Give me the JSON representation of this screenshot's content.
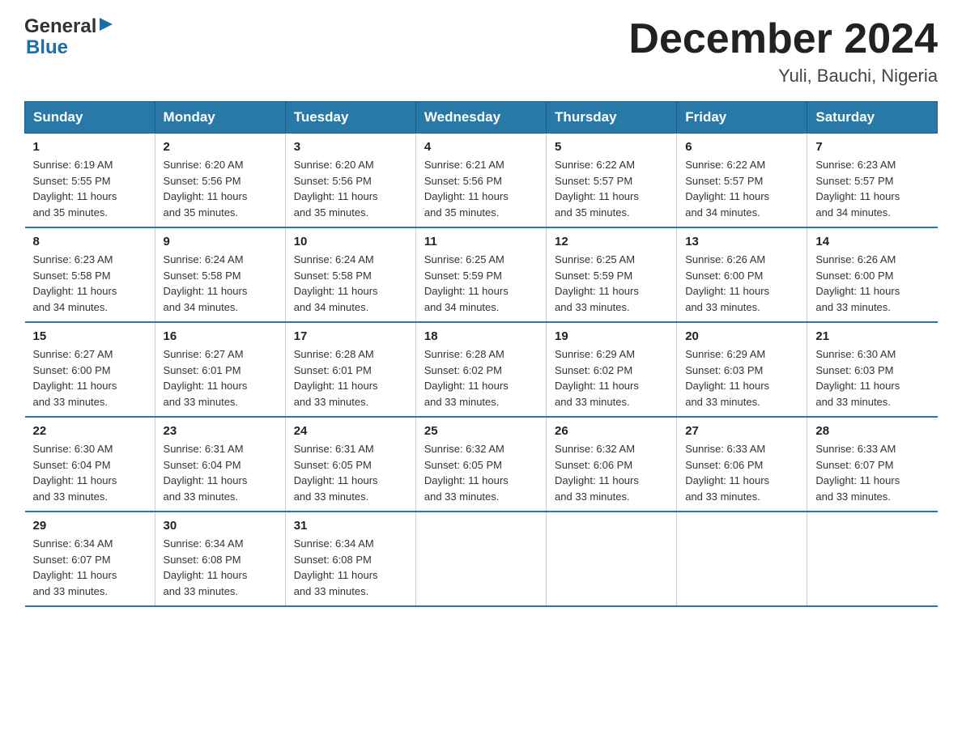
{
  "logo": {
    "general": "General",
    "arrow": "▶",
    "blue": "Blue"
  },
  "title": "December 2024",
  "location": "Yuli, Bauchi, Nigeria",
  "days_of_week": [
    "Sunday",
    "Monday",
    "Tuesday",
    "Wednesday",
    "Thursday",
    "Friday",
    "Saturday"
  ],
  "weeks": [
    [
      {
        "day": "1",
        "sunrise": "6:19 AM",
        "sunset": "5:55 PM",
        "daylight": "11 hours and 35 minutes."
      },
      {
        "day": "2",
        "sunrise": "6:20 AM",
        "sunset": "5:56 PM",
        "daylight": "11 hours and 35 minutes."
      },
      {
        "day": "3",
        "sunrise": "6:20 AM",
        "sunset": "5:56 PM",
        "daylight": "11 hours and 35 minutes."
      },
      {
        "day": "4",
        "sunrise": "6:21 AM",
        "sunset": "5:56 PM",
        "daylight": "11 hours and 35 minutes."
      },
      {
        "day": "5",
        "sunrise": "6:22 AM",
        "sunset": "5:57 PM",
        "daylight": "11 hours and 35 minutes."
      },
      {
        "day": "6",
        "sunrise": "6:22 AM",
        "sunset": "5:57 PM",
        "daylight": "11 hours and 34 minutes."
      },
      {
        "day": "7",
        "sunrise": "6:23 AM",
        "sunset": "5:57 PM",
        "daylight": "11 hours and 34 minutes."
      }
    ],
    [
      {
        "day": "8",
        "sunrise": "6:23 AM",
        "sunset": "5:58 PM",
        "daylight": "11 hours and 34 minutes."
      },
      {
        "day": "9",
        "sunrise": "6:24 AM",
        "sunset": "5:58 PM",
        "daylight": "11 hours and 34 minutes."
      },
      {
        "day": "10",
        "sunrise": "6:24 AM",
        "sunset": "5:58 PM",
        "daylight": "11 hours and 34 minutes."
      },
      {
        "day": "11",
        "sunrise": "6:25 AM",
        "sunset": "5:59 PM",
        "daylight": "11 hours and 34 minutes."
      },
      {
        "day": "12",
        "sunrise": "6:25 AM",
        "sunset": "5:59 PM",
        "daylight": "11 hours and 33 minutes."
      },
      {
        "day": "13",
        "sunrise": "6:26 AM",
        "sunset": "6:00 PM",
        "daylight": "11 hours and 33 minutes."
      },
      {
        "day": "14",
        "sunrise": "6:26 AM",
        "sunset": "6:00 PM",
        "daylight": "11 hours and 33 minutes."
      }
    ],
    [
      {
        "day": "15",
        "sunrise": "6:27 AM",
        "sunset": "6:00 PM",
        "daylight": "11 hours and 33 minutes."
      },
      {
        "day": "16",
        "sunrise": "6:27 AM",
        "sunset": "6:01 PM",
        "daylight": "11 hours and 33 minutes."
      },
      {
        "day": "17",
        "sunrise": "6:28 AM",
        "sunset": "6:01 PM",
        "daylight": "11 hours and 33 minutes."
      },
      {
        "day": "18",
        "sunrise": "6:28 AM",
        "sunset": "6:02 PM",
        "daylight": "11 hours and 33 minutes."
      },
      {
        "day": "19",
        "sunrise": "6:29 AM",
        "sunset": "6:02 PM",
        "daylight": "11 hours and 33 minutes."
      },
      {
        "day": "20",
        "sunrise": "6:29 AM",
        "sunset": "6:03 PM",
        "daylight": "11 hours and 33 minutes."
      },
      {
        "day": "21",
        "sunrise": "6:30 AM",
        "sunset": "6:03 PM",
        "daylight": "11 hours and 33 minutes."
      }
    ],
    [
      {
        "day": "22",
        "sunrise": "6:30 AM",
        "sunset": "6:04 PM",
        "daylight": "11 hours and 33 minutes."
      },
      {
        "day": "23",
        "sunrise": "6:31 AM",
        "sunset": "6:04 PM",
        "daylight": "11 hours and 33 minutes."
      },
      {
        "day": "24",
        "sunrise": "6:31 AM",
        "sunset": "6:05 PM",
        "daylight": "11 hours and 33 minutes."
      },
      {
        "day": "25",
        "sunrise": "6:32 AM",
        "sunset": "6:05 PM",
        "daylight": "11 hours and 33 minutes."
      },
      {
        "day": "26",
        "sunrise": "6:32 AM",
        "sunset": "6:06 PM",
        "daylight": "11 hours and 33 minutes."
      },
      {
        "day": "27",
        "sunrise": "6:33 AM",
        "sunset": "6:06 PM",
        "daylight": "11 hours and 33 minutes."
      },
      {
        "day": "28",
        "sunrise": "6:33 AM",
        "sunset": "6:07 PM",
        "daylight": "11 hours and 33 minutes."
      }
    ],
    [
      {
        "day": "29",
        "sunrise": "6:34 AM",
        "sunset": "6:07 PM",
        "daylight": "11 hours and 33 minutes."
      },
      {
        "day": "30",
        "sunrise": "6:34 AM",
        "sunset": "6:08 PM",
        "daylight": "11 hours and 33 minutes."
      },
      {
        "day": "31",
        "sunrise": "6:34 AM",
        "sunset": "6:08 PM",
        "daylight": "11 hours and 33 minutes."
      },
      null,
      null,
      null,
      null
    ]
  ],
  "labels": {
    "sunrise": "Sunrise:",
    "sunset": "Sunset:",
    "daylight": "Daylight:"
  }
}
